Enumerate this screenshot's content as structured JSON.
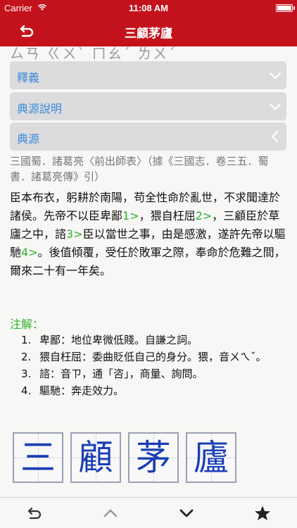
{
  "status_bar": {
    "carrier": "Carrier",
    "time": "11:08 AM"
  },
  "nav": {
    "title": "三顧茅廬",
    "back_icon": "back-arrow-icon"
  },
  "phonetic": "ㄙㄢ  ㄍㄨˋ  ㄇㄠˊ  ㄌㄨˊ",
  "sections": [
    {
      "label": "釋義",
      "state": "collapsed"
    },
    {
      "label": "典源說明",
      "state": "collapsed"
    },
    {
      "label": "典源",
      "state": "expanded"
    }
  ],
  "source_line": "三國蜀．諸葛亮〈前出師表〉（據《三國志．卷三五．蜀書．諸葛亮傳》引）",
  "body": {
    "p1": "臣本布衣，躬耕於南陽，苟全性命於亂世，不求聞達於諸侯。先帝不以臣卑鄙",
    "m1": "1>",
    "p2": "，猥自枉屈",
    "m2": "2>",
    "p3": "，三顧臣於草廬之中，諮",
    "m3": "3>",
    "p4": "臣以當世之事，由是感激，遂許先帝以驅馳",
    "m4": "4>",
    "p5": "。後值傾覆，受任於敗軍之際，奉命於危難之間，爾來二十有一年矣。"
  },
  "notes": {
    "title": "注解：",
    "items": [
      {
        "num": "1.",
        "text": "卑鄙：地位卑微低賤。自謙之詞。"
      },
      {
        "num": "2.",
        "text": "猥自枉屈：委曲貶低自己的身分。猥，音ㄨㄟˇ。"
      },
      {
        "num": "3.",
        "text": "諮：音ㄗ，通「咨」，商量、詢問。"
      },
      {
        "num": "4.",
        "text": "驅馳：奔走效力。"
      }
    ]
  },
  "characters": [
    "三",
    "顧",
    "茅",
    "廬"
  ],
  "toolbar": {
    "buttons": [
      "back-arrow-icon",
      "chevron-up-icon",
      "chevron-down-icon",
      "star-icon"
    ]
  },
  "colors": {
    "brand_red": "#c4121c",
    "link_blue": "#3b8ad9",
    "note_green": "#2fb22f",
    "glyph_blue": "#1a3fb5"
  }
}
